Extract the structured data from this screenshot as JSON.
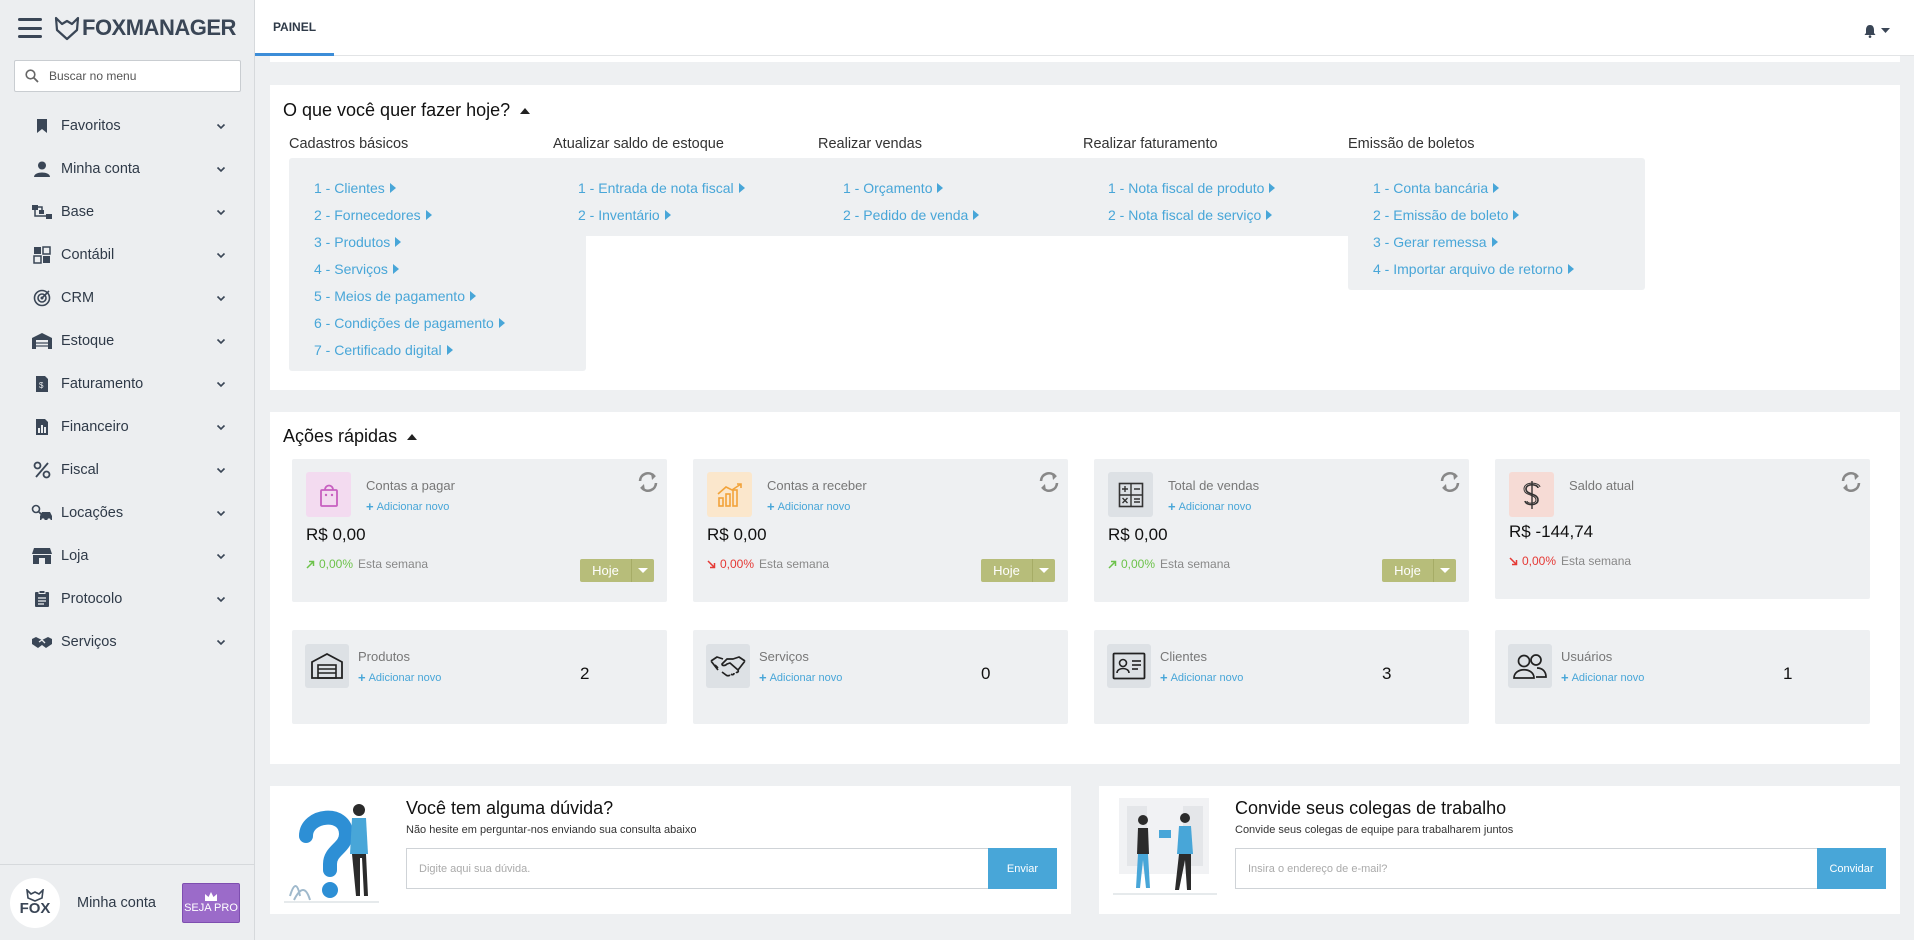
{
  "app": {
    "logo_text": "FOXMANAGER"
  },
  "sidebar": {
    "search_placeholder": "Buscar no menu",
    "items": [
      {
        "label": "Favoritos",
        "icon": "bookmark-icon"
      },
      {
        "label": "Minha conta",
        "icon": "user-icon"
      },
      {
        "label": "Base",
        "icon": "sitemap-icon"
      },
      {
        "label": "Contábil",
        "icon": "calculator-icon"
      },
      {
        "label": "CRM",
        "icon": "target-icon"
      },
      {
        "label": "Estoque",
        "icon": "warehouse-icon"
      },
      {
        "label": "Faturamento",
        "icon": "invoice-icon"
      },
      {
        "label": "Financeiro",
        "icon": "report-icon"
      },
      {
        "label": "Fiscal",
        "icon": "percent-icon"
      },
      {
        "label": "Locações",
        "icon": "car-key-icon"
      },
      {
        "label": "Loja",
        "icon": "store-icon"
      },
      {
        "label": "Protocolo",
        "icon": "clipboard-icon"
      },
      {
        "label": "Serviços",
        "icon": "handshake-icon"
      }
    ],
    "footer": {
      "avatar_text": "FOX",
      "label": "Minha conta",
      "pro_label": "SEJA PRO"
    }
  },
  "topbar": {
    "tab_label": "PAINEL"
  },
  "todo": {
    "title": "O que você quer fazer hoje?",
    "columns": [
      {
        "title": "Cadastros básicos",
        "links": [
          "1 - Clientes",
          "2 - Fornecedores",
          "3 - Produtos",
          "4 - Serviços",
          "5 - Meios de pagamento",
          "6 - Condições de pagamento",
          "7 - Certificado digital"
        ]
      },
      {
        "title": "Atualizar saldo de estoque",
        "links": [
          "1 - Entrada de nota fiscal",
          "2 - Inventário"
        ]
      },
      {
        "title": "Realizar vendas",
        "links": [
          "1 - Orçamento",
          "2 - Pedido de venda"
        ]
      },
      {
        "title": "Realizar faturamento",
        "links": [
          "1 - Nota fiscal de produto",
          "2 - Nota fiscal de serviço"
        ]
      },
      {
        "title": "Emissão de boletos",
        "links": [
          "1 - Conta bancária",
          "2 - Emissão de boleto",
          "3 - Gerar remessa",
          "4 - Importar arquivo de retorno"
        ]
      }
    ]
  },
  "quick": {
    "title": "Ações rápidas",
    "add_label": "Adicionar novo",
    "week_label": "Esta semana",
    "period_label": "Hoje",
    "stats": [
      {
        "title": "Contas a pagar",
        "value": "R$ 0,00",
        "pct": "0,00%",
        "trend": "up",
        "icon": "shopping-bag-icon",
        "icon_bg": "#f3dbf0",
        "icon_color": "#c75fc0"
      },
      {
        "title": "Contas a receber",
        "value": "R$ 0,00",
        "pct": "0,00%",
        "trend": "down",
        "icon": "growth-chart-icon",
        "icon_bg": "#fbe7cc",
        "icon_color": "#f2a33a"
      },
      {
        "title": "Total de vendas",
        "value": "R$ 0,00",
        "pct": "0,00%",
        "trend": "up",
        "icon": "calculator-icon",
        "icon_bg": "#dde1e5",
        "icon_color": "#333333"
      },
      {
        "title": "Saldo atual",
        "value": "R$ -144,74",
        "pct": "0,00%",
        "trend": "down",
        "icon": "dollar-icon",
        "icon_bg": "#f6dbd5",
        "icon_color": "#333333"
      }
    ],
    "counts": [
      {
        "title": "Produtos",
        "count": "2",
        "icon": "warehouse-icon"
      },
      {
        "title": "Serviços",
        "count": "0",
        "icon": "handshake-icon"
      },
      {
        "title": "Clientes",
        "count": "3",
        "icon": "id-card-icon"
      },
      {
        "title": "Usuários",
        "count": "1",
        "icon": "users-icon"
      }
    ]
  },
  "help": {
    "title": "Você tem alguma dúvida?",
    "subtitle": "Não hesite em perguntar-nos enviando sua consulta abaixo",
    "placeholder": "Digite aqui sua dúvida.",
    "button": "Enviar"
  },
  "invite": {
    "title": "Convide seus colegas de trabalho",
    "subtitle": "Convide seus colegas de equipe para trabalharem juntos",
    "placeholder": "Insira o endereço de e-mail?",
    "button": "Convidar"
  },
  "colors": {
    "accent": "#48a6d8",
    "tab_underline": "#3c8dd8",
    "period_button": "#b7bd7a",
    "pro_button": "#9b6bc9",
    "trend_up": "#6cc24a",
    "trend_down": "#e53935"
  }
}
